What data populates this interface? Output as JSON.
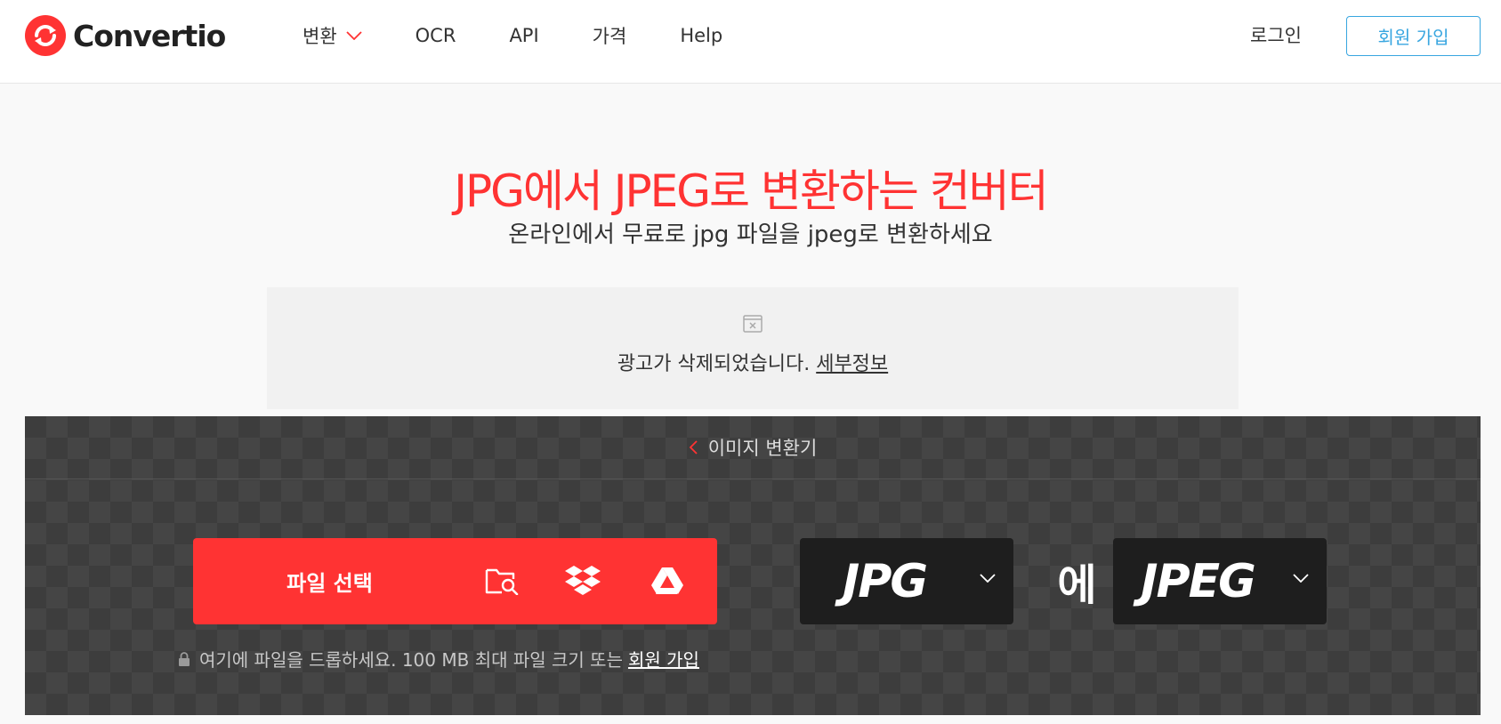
{
  "header": {
    "brand": "Convertio",
    "nav": [
      {
        "label": "변환",
        "has_dropdown": true
      },
      {
        "label": "OCR"
      },
      {
        "label": "API"
      },
      {
        "label": "가격"
      },
      {
        "label": "Help"
      }
    ],
    "login_label": "로그인",
    "signup_label": "회원 가입"
  },
  "hero": {
    "title": "JPG에서 JPEG로 변환하는 컨버터",
    "subtitle": "온라인에서 무료로 jpg 파일을 jpeg로 변환하세요"
  },
  "ad": {
    "text": "광고가 삭제되었습니다.",
    "link": "세부정보"
  },
  "converter": {
    "back_label": "이미지 변환기",
    "choose_files_label": "파일 선택",
    "sources": [
      "folder-search-icon",
      "dropbox-icon",
      "google-drive-icon"
    ],
    "drop_note": "여기에 파일을 드롭하세요. 100 MB 최대 파일 크기 또는",
    "drop_link": "회원 가입",
    "from_format": "JPG",
    "separator": "에",
    "to_format": "JPEG"
  },
  "colors": {
    "brand_red": "#ff3333",
    "signup_blue": "#38a6e0",
    "panel_dark": "#3d3d3d",
    "format_box": "#1e1e1e"
  }
}
